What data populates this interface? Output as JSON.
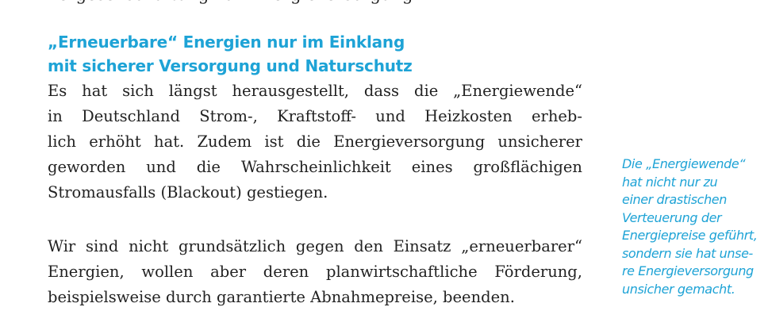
{
  "cut_line": "Vergesellschaftung von Energieversorgung",
  "heading": {
    "line1": "„Erneuerbare“ Energien nur im Einklang",
    "line2": "mit sicherer Versorgung und Naturschutz"
  },
  "paragraph1": [
    "Es hat sich längst herausgestellt, dass die „Energiewende“",
    "in Deutschland Strom-, Kraftstoff- und Heizkosten erheb-",
    "lich erhöht hat. Zudem ist die Energieversorgung unsicherer",
    "geworden und die Wahrscheinlichkeit eines großflächigen",
    "Stromausfalls (Blackout) gestiegen."
  ],
  "paragraph2": [
    "Wir sind nicht grundsätzlich gegen den Einsatz „erneuerbarer“",
    "Energien, wollen aber deren planwirtschaftliche Förderung,",
    "beispielsweise durch garantierte Abnahmepreise, beenden."
  ],
  "sidenote": [
    "Die „Energiewende“",
    "hat nicht nur zu",
    "einer drastischen",
    "Verteuerung der",
    "Energiepreise geführt,",
    "sondern sie hat unse-",
    "re Energieversorgung",
    "unsicher gemacht."
  ],
  "colors": {
    "accent": "#1ea3d6",
    "text": "#222222",
    "background": "#ffffff"
  }
}
